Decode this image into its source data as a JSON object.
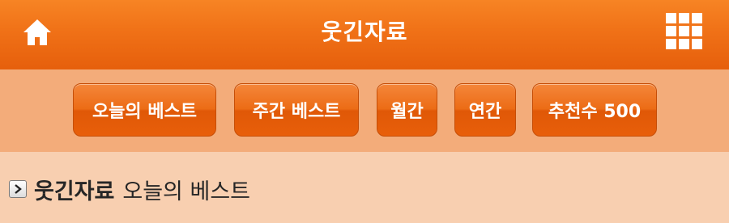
{
  "header": {
    "title": "웃긴자료",
    "home_icon": "home-icon",
    "menu_icon": "grid-menu-icon"
  },
  "tabs": [
    {
      "label": "오늘의 베스트"
    },
    {
      "label": "주간 베스트"
    },
    {
      "label": "월간"
    },
    {
      "label": "연간"
    },
    {
      "label": "추천수 500"
    }
  ],
  "section": {
    "board": "웃긴자료",
    "title": "오늘의 베스트",
    "icon": "chevron-right-icon"
  },
  "colors": {
    "header": "#f07117",
    "tab_bar": "#f3ac7a",
    "tab_button": "#ec6c16",
    "section_bg": "#f8cfb0"
  }
}
